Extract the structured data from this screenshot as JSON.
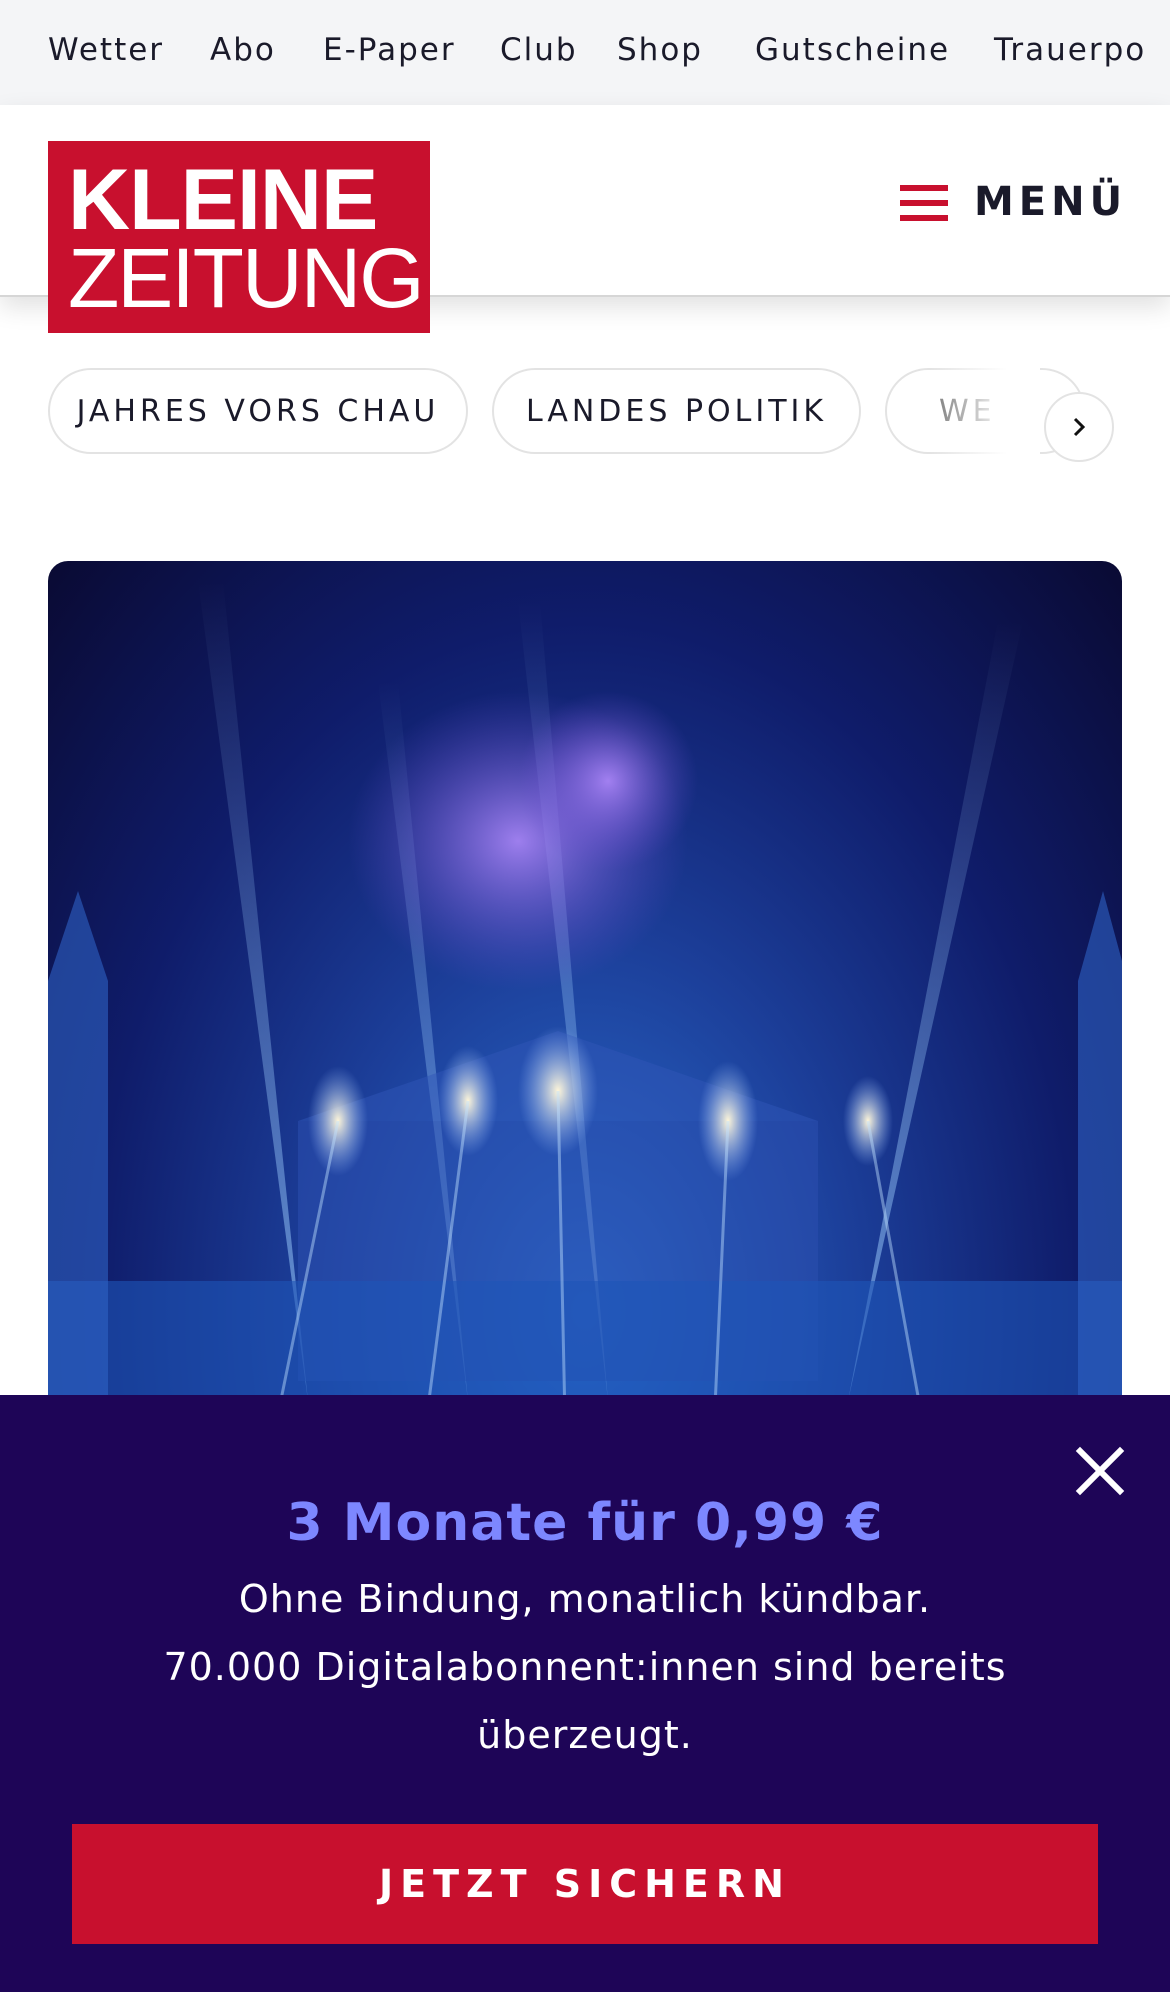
{
  "topbar": {
    "items": [
      {
        "label": "Wetter"
      },
      {
        "label": "Abo"
      },
      {
        "label": "E-Paper"
      },
      {
        "label": "Club"
      },
      {
        "label": "Shop"
      },
      {
        "label": "Gutscheine"
      },
      {
        "label": "Trauerpo"
      }
    ]
  },
  "header": {
    "logo_line1": "KLEINE",
    "logo_line2": "ZEITUNG",
    "menu_label": "MENÜ",
    "brand_color": "#c8102e"
  },
  "chips": {
    "items": [
      {
        "label": "JAHRES VORS CHAU"
      },
      {
        "label": "LANDES POLITIK"
      },
      {
        "label": "WE"
      }
    ],
    "next_icon": "chevron-right-icon"
  },
  "hero": {
    "alt_subject": "water fountain light show"
  },
  "paywall": {
    "title": "3 Monate für 0,99 €",
    "line1": "Ohne Bindung, monatlich kündbar.",
    "line2": "70.000 Digitalabonnent:innen sind bereits überzeugt.",
    "cta_label": "JETZT SICHERN",
    "background_color": "#1e0557",
    "title_color": "#7d87ff",
    "close_icon": "close-icon"
  }
}
